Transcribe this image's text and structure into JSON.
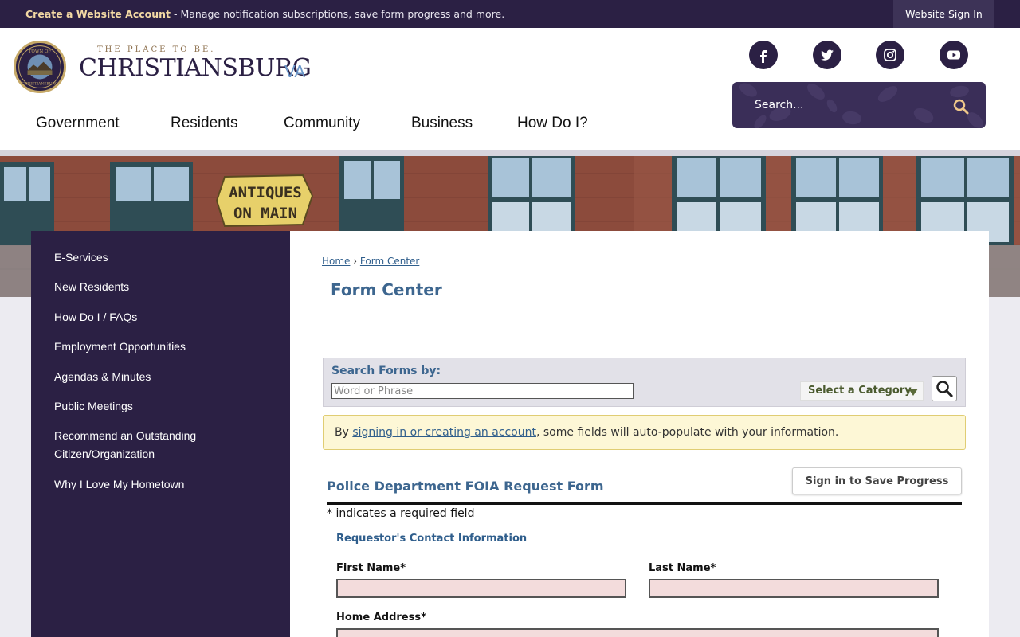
{
  "topbar": {
    "create_account_link": "Create a Website Account",
    "message": " - Manage notification subscriptions, save form progress and more.",
    "sign_in": "Website Sign In"
  },
  "header": {
    "tagline": "THE PLACE TO BE.",
    "town_name": "CHRISTIANSBURG",
    "state": "VA",
    "seal_text_top": "TOWN OF",
    "seal_text_bottom": "CHRISTIANSBURG",
    "social": [
      {
        "name": "facebook-icon",
        "glyph": "f"
      },
      {
        "name": "twitter-icon",
        "glyph": ""
      },
      {
        "name": "instagram-icon",
        "glyph": ""
      },
      {
        "name": "youtube-icon",
        "glyph": ""
      }
    ],
    "search_placeholder": "Search..."
  },
  "main_nav": [
    "Government",
    "Residents",
    "Community",
    "Business",
    "How Do I?"
  ],
  "banner": {
    "sign_line1": "ANTIQUES",
    "sign_line2": "ON MAIN"
  },
  "sidebar": {
    "items": [
      "E-Services",
      "New Residents",
      "How Do I / FAQs",
      "Employment Opportunities",
      "Agendas & Minutes",
      "Public Meetings",
      "Recommend an Outstanding Citizen/Organization",
      "Why I Love My Hometown"
    ]
  },
  "breadcrumb": {
    "home": "Home",
    "separator": "›",
    "current": "Form Center"
  },
  "page_title": "Form Center",
  "search_forms": {
    "label": "Search Forms by:",
    "placeholder": "Word or Phrase",
    "category": "Select a Category"
  },
  "notice": {
    "prefix": "By ",
    "link": "signing in or creating an account",
    "suffix": ", some fields will auto-populate with your information."
  },
  "form": {
    "title": "Police Department FOIA Request Form",
    "save_button": "Sign in to Save Progress",
    "required_note": "* indicates a required field",
    "section": "Requestor's Contact Information",
    "first_name": "First Name*",
    "last_name": "Last Name*",
    "home_address": "Home Address*"
  },
  "colors": {
    "brand_purple": "#2b2044",
    "title_blue": "#3d668f",
    "required_pink": "#f3dcdc",
    "notice_yellow": "#fdf7d6"
  }
}
